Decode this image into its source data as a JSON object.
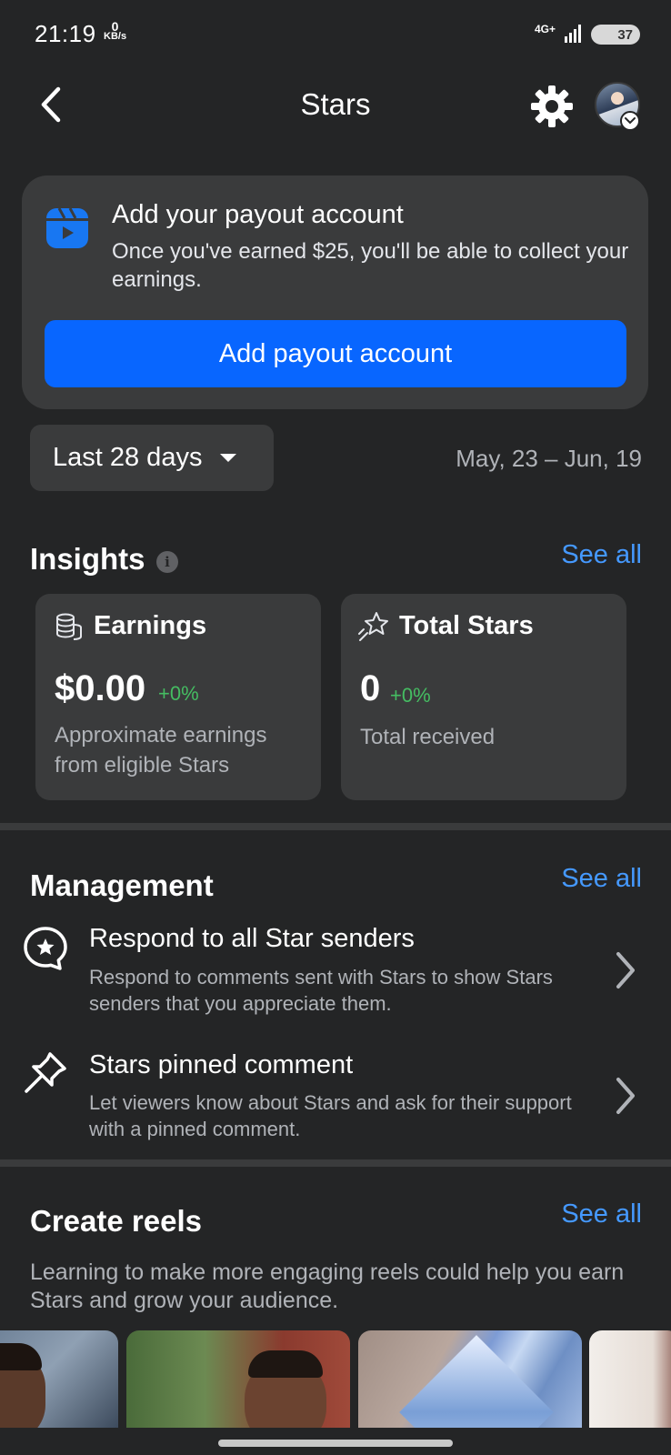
{
  "status_bar": {
    "time": "21:19",
    "data_rate_value": "0",
    "data_rate_unit": "KB/s",
    "network": "4G+",
    "battery": "37"
  },
  "header": {
    "title": "Stars",
    "back_icon": "chevron-left-icon",
    "settings_icon": "gear-icon"
  },
  "payout": {
    "title": "Add your payout account",
    "description": "Once you've earned $25, you'll be able to collect your earnings.",
    "button_label": "Add payout account",
    "accent": "#0866ff"
  },
  "range": {
    "label": "Last 28 days",
    "dates": "May, 23 – Jun, 19"
  },
  "insights": {
    "title": "Insights",
    "see_all": "See all",
    "cards": [
      {
        "icon": "coins-icon",
        "title": "Earnings",
        "value": "$0.00",
        "change": "+0%",
        "description": "Approximate earnings from eligible Stars"
      },
      {
        "icon": "stars-icon",
        "title": "Total Stars",
        "value": "0",
        "change": "+0%",
        "description": "Total received"
      }
    ]
  },
  "management": {
    "title": "Management",
    "see_all": "See all",
    "items": [
      {
        "icon": "star-chat-bubble-icon",
        "title": "Respond to all Star senders",
        "description": "Respond to comments sent with Stars to show Stars senders that you appreciate them."
      },
      {
        "icon": "pin-icon",
        "title": "Stars pinned comment",
        "description": "Let viewers know about Stars and ask for their support with a pinned comment."
      }
    ]
  },
  "create_reels": {
    "title": "Create reels",
    "see_all": "See all",
    "description": "Learning to make more engaging reels could help you earn Stars and grow your audience."
  },
  "colors": {
    "background": "#242526",
    "card": "#3a3b3c",
    "link": "#4599ff",
    "positive": "#45bd62"
  }
}
